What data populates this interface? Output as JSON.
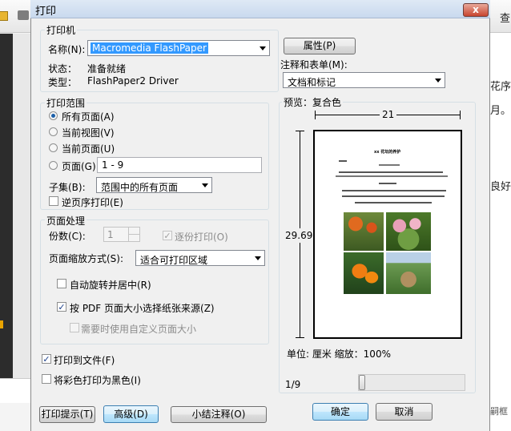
{
  "background": {
    "right_fragments": [
      "查",
      "花序",
      "月。",
      "良好",
      "嗣框"
    ]
  },
  "dialog": {
    "title": "打印",
    "close_glyph": "x",
    "printer": {
      "group_label": "打印机",
      "name_label": "名称(N):",
      "name_value": "Macromedia FlashPaper",
      "properties_button": "属性(P)",
      "status_label": "状态：",
      "status_value": "准备就绪",
      "type_label": "类型：",
      "type_value": "FlashPaper2 Driver",
      "comments_label": "注释和表单(M):",
      "comments_value": "文档和标记"
    },
    "range": {
      "group_label": "打印范围",
      "all_pages": "所有页面(A)",
      "current_view": "当前视图(V)",
      "current_page": "当前页面(U)",
      "pages": "页面(G)",
      "pages_value": "1 - 9",
      "subset_label": "子集(B):",
      "subset_value": "范围中的所有页面",
      "reverse_pages": "逆页序打印(E)"
    },
    "handling": {
      "group_label": "页面处理",
      "copies_label": "份数(C):",
      "copies_value": "1",
      "collate": "逐份打印(O)",
      "scaling_label": "页面缩放方式(S):",
      "scaling_value": "适合可打印区域",
      "auto_rotate": "自动旋转并居中(R)",
      "pdf_page_size": "按 PDF 页面大小选择纸张来源(Z)",
      "custom_page_size": "需要时使用自定义页面大小"
    },
    "print_to_file": "打印到文件(F)",
    "print_color_as_black": "将彩色打印为黑色(I)",
    "preview": {
      "label": "预览：复合色",
      "width_value": "21",
      "height_value": "29.69",
      "units_text": "单位: 厘米 缩放：100%",
      "page_indicator": "1/9",
      "doc_title": "xx 花坛的养护",
      "page_position": 0.0
    },
    "buttons": {
      "print_tips": "打印提示(T)",
      "advanced": "高级(D)",
      "summarize_comments": "小结注释(O)",
      "ok": "确定",
      "cancel": "取消"
    }
  }
}
